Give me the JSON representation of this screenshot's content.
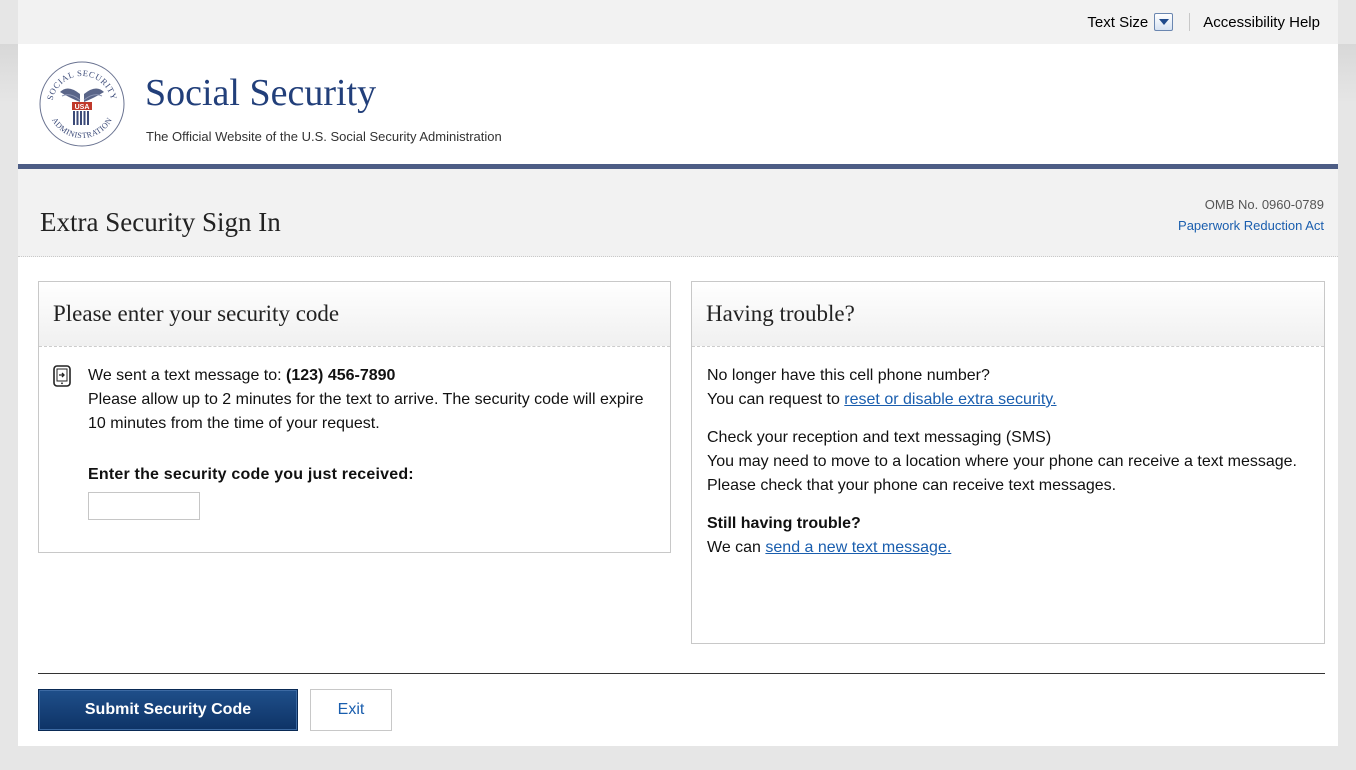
{
  "utility": {
    "text_size_label": "Text Size",
    "accessibility_label": "Accessibility Help"
  },
  "header": {
    "title": "Social Security",
    "subtitle": "The Official Website of the U.S. Social Security Administration",
    "logo_top_text": "SOCIAL SECURITY",
    "logo_bottom_text": "ADMINISTRATION",
    "logo_center_text": "USA"
  },
  "page": {
    "title": "Extra Security Sign In",
    "omb_number": "OMB No. 0960-0789",
    "paperwork_link": "Paperwork Reduction Act"
  },
  "code_panel": {
    "heading": "Please enter your security code",
    "sent_prefix": "We sent a text message to: ",
    "phone_number": "(123) 456-7890",
    "instructions": "Please allow up to 2 minutes for the text to arrive. The security code will expire 10 minutes from the time of your request.",
    "input_label": "Enter the security code you just received:",
    "input_value": ""
  },
  "trouble_panel": {
    "heading": "Having trouble?",
    "no_longer_q": "No longer have this cell phone number?",
    "request_prefix": "You can request to ",
    "reset_link": "reset or disable extra security.",
    "reception_title": "Check your reception and text messaging (SMS)",
    "reception_text": "You may need to move to a location where your phone can receive a text message. Please check that your phone can receive text messages.",
    "still_title": "Still having trouble?",
    "we_can_prefix": "We can ",
    "new_text_link": "send a new text message."
  },
  "actions": {
    "submit_label": "Submit Security Code",
    "exit_label": "Exit"
  },
  "colors": {
    "brand_blue": "#223f7a",
    "header_rule": "#4d5d85",
    "link": "#1a5eae",
    "submit_bg": "#0e3366"
  }
}
